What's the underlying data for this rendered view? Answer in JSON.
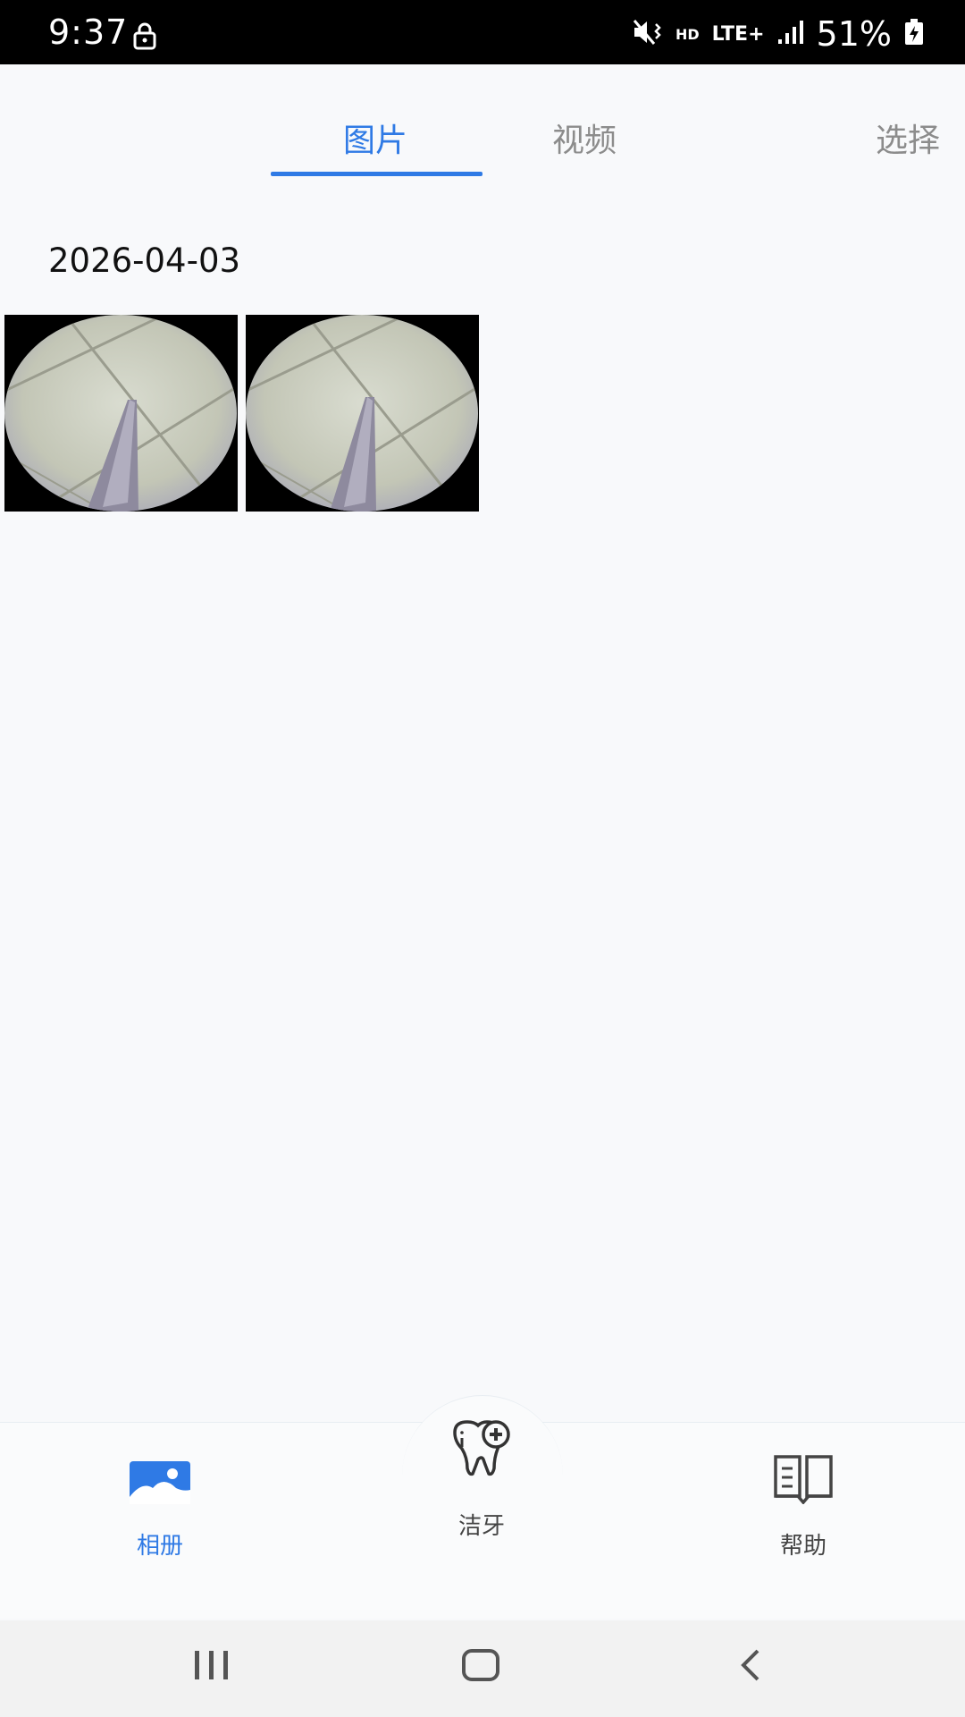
{
  "status_bar": {
    "time": "9:37",
    "network": "LTE+",
    "hd": "HD",
    "battery": "51%"
  },
  "tabs": [
    {
      "label": "图片",
      "active": true
    },
    {
      "label": "视频",
      "active": false
    }
  ],
  "select_label": "选择",
  "gallery": {
    "date": "2026-04-03",
    "thumbnails": [
      {
        "icon": "endoscope-photo"
      },
      {
        "icon": "endoscope-photo"
      }
    ]
  },
  "bottom_nav": {
    "album": {
      "label": "相册",
      "icon": "image-icon",
      "active": true
    },
    "clean": {
      "label": "洁牙",
      "icon": "tooth-icon"
    },
    "help": {
      "label": "帮助",
      "icon": "book-icon"
    }
  },
  "colors": {
    "accent": "#2f7ae5",
    "inactive": "#8c8c8c",
    "background": "#f8f9fb"
  }
}
